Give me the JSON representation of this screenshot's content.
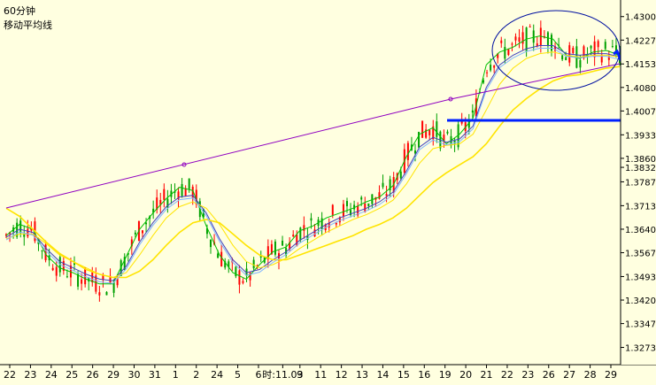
{
  "header": {
    "timeframe": "60分钟",
    "indicator": "移动平均线"
  },
  "colors": {
    "background": "#ffffe0",
    "up_candle": "#ff0000",
    "down_candle": "#00a000",
    "ma_short": "#00c000",
    "ma_mid": "#4040c0",
    "ma_long": "#ffe400",
    "trendline": "#9000c0",
    "annotation": "#0020ff"
  },
  "chart_data": {
    "type": "line",
    "title": "",
    "ylabel": "",
    "xlabel": "",
    "ylim": [
      1.3225,
      1.4335
    ],
    "y_ticks": [
      "1.4300",
      "1.4227",
      "1.4153",
      "1.4080",
      "1.4007",
      "1.3933",
      "1.3860",
      "1.3832",
      "1.3787",
      "1.3713",
      "1.3640",
      "1.3567",
      "1.3493",
      "1.3420",
      "1.3347",
      "1.3273"
    ],
    "x_ticks": [
      "22",
      "23",
      "24",
      "25",
      "26",
      "29",
      "30",
      "31",
      "1",
      "2",
      "24",
      "5",
      "6",
      "时:11.03",
      "9",
      "11",
      "12",
      "13",
      "14",
      "15",
      "16",
      "19",
      "20",
      "21",
      "22",
      "23",
      "26",
      "27",
      "28",
      "29"
    ],
    "current_price": 1.3832,
    "series": [
      {
        "values": [
          1.362,
          1.3655,
          1.364,
          1.356,
          1.352,
          1.3505,
          1.3485,
          1.347,
          1.347,
          1.3555,
          1.364,
          1.369,
          1.3735,
          1.377,
          1.376,
          1.365,
          1.356,
          1.3505,
          1.3485,
          1.353,
          1.357,
          1.3585,
          1.3635,
          1.365,
          1.3675,
          1.369,
          1.3705,
          1.3725,
          1.374,
          1.3775,
          1.3865,
          1.3935,
          1.3955,
          1.3905,
          1.3935,
          1.3985,
          1.415,
          1.419,
          1.4205,
          1.423,
          1.424,
          1.423,
          1.418,
          1.417,
          1.419,
          1.4195,
          1.418
        ]
      },
      {
        "values": [
          1.3615,
          1.364,
          1.363,
          1.358,
          1.354,
          1.352,
          1.35,
          1.3485,
          1.348,
          1.3525,
          1.36,
          1.366,
          1.371,
          1.374,
          1.3745,
          1.369,
          1.361,
          1.3545,
          1.3505,
          1.3515,
          1.3545,
          1.357,
          1.3605,
          1.363,
          1.3655,
          1.3675,
          1.369,
          1.3705,
          1.3725,
          1.3755,
          1.382,
          1.3895,
          1.3925,
          1.391,
          1.392,
          1.396,
          1.408,
          1.415,
          1.418,
          1.42,
          1.421,
          1.421,
          1.4185,
          1.418,
          1.4185,
          1.4185,
          1.4175
        ]
      },
      {
        "values": [
          1.361,
          1.3625,
          1.3625,
          1.3595,
          1.356,
          1.354,
          1.352,
          1.35,
          1.349,
          1.3505,
          1.356,
          1.362,
          1.3675,
          1.371,
          1.3725,
          1.3705,
          1.3655,
          1.359,
          1.354,
          1.352,
          1.353,
          1.355,
          1.358,
          1.3605,
          1.363,
          1.365,
          1.367,
          1.3685,
          1.3705,
          1.373,
          1.378,
          1.3845,
          1.389,
          1.39,
          1.3905,
          1.3935,
          1.401,
          1.409,
          1.414,
          1.417,
          1.4185,
          1.419,
          1.418,
          1.4175,
          1.418,
          1.418,
          1.4175
        ]
      },
      {
        "values": [
          1.3705,
          1.368,
          1.364,
          1.36,
          1.3565,
          1.354,
          1.3515,
          1.35,
          1.349,
          1.349,
          1.351,
          1.3545,
          1.359,
          1.363,
          1.366,
          1.367,
          1.366,
          1.3625,
          1.359,
          1.356,
          1.3545,
          1.3545,
          1.356,
          1.3575,
          1.359,
          1.3605,
          1.362,
          1.364,
          1.3655,
          1.3675,
          1.3705,
          1.3745,
          1.3785,
          1.3815,
          1.384,
          1.3865,
          1.3905,
          1.396,
          1.401,
          1.4045,
          1.4075,
          1.41,
          1.4115,
          1.412,
          1.413,
          1.414,
          1.4145
        ]
      }
    ]
  }
}
